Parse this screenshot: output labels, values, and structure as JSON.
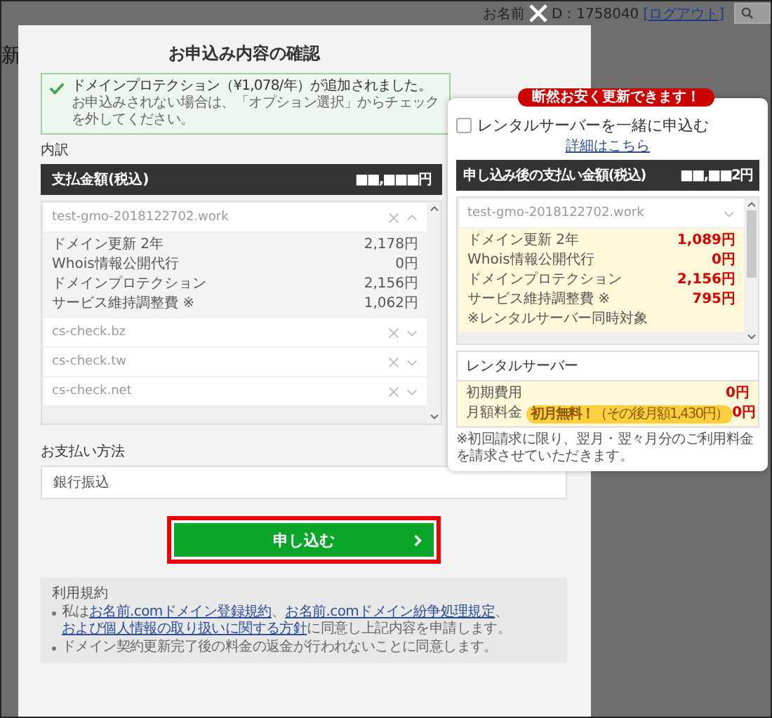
{
  "page_header": {
    "user_label": "お名前",
    "user_id": "D：1758040",
    "logout_link": "[ログアウト]",
    "side_text": "新"
  },
  "modal": {
    "title": "お申込み内容の確認",
    "notice": {
      "message": "ドメインプロテクション（¥1,078/年）が追加されました。",
      "sub": "お申込みされない場合は、「オプション選択」からチェックを外してください。"
    },
    "breakdown_label": "内訳",
    "total": {
      "label": "支払金額(税込)",
      "amount": "■■,■■■円"
    },
    "domains": [
      {
        "name": "test-gmo-2018122702.work",
        "expanded": true,
        "lines": [
          {
            "label": "ドメイン更新 2年",
            "amount": "2,178円"
          },
          {
            "label": "Whois情報公開代行",
            "amount": "0円"
          },
          {
            "label": "ドメインプロテクション",
            "amount": "2,156円"
          },
          {
            "label": "サービス維持調整費 ※",
            "amount": "1,062円"
          }
        ]
      },
      {
        "name": "cs-check.bz",
        "expanded": false
      },
      {
        "name": "cs-check.tw",
        "expanded": false
      },
      {
        "name": "cs-check.net",
        "expanded": false
      }
    ],
    "payment": {
      "label": "お支払い方法",
      "value": "銀行振込"
    },
    "submit": "申し込む",
    "terms": {
      "title": "利用規約",
      "items": [
        [
          {
            "kind": "text",
            "text": "私は"
          },
          {
            "kind": "link",
            "text": "お名前.comドメイン登録規約",
            "after": "、"
          },
          {
            "kind": "link",
            "text": "お名前.comドメイン紛争処理規定",
            "after": "、"
          },
          {
            "kind": "link",
            "text": "および個人情報の取り扱いに関する方針"
          },
          {
            "kind": "text",
            "text": "に同意し上記内容を申請します。"
          }
        ],
        [
          {
            "kind": "text",
            "text": "ドメイン契約更新完了後の料金の返金が行われないことに同意します。"
          }
        ]
      ]
    }
  },
  "popup": {
    "badge": "断然お安く更新できます！",
    "checkbox": {
      "label": "レンタルサーバーを一緒に申込む",
      "checked": false
    },
    "details_link": "詳細はこちら",
    "total": {
      "label": "申し込み後の支払い金額(税込)",
      "amount": "■■,■■2円"
    },
    "domain": {
      "name": "test-gmo-2018122702.work",
      "expanded": false,
      "lines": [
        {
          "label": "ドメイン更新 2年",
          "amount": "1,089円"
        },
        {
          "label": "Whois情報公開代行",
          "amount": "0円"
        },
        {
          "label": "ドメインプロテクション",
          "amount": "2,156円"
        },
        {
          "label": "サービス維持調整費 ※",
          "amount": "795円"
        }
      ],
      "note": "※レンタルサーバー同時対象"
    },
    "server": {
      "title": "レンタルサーバー",
      "lines": [
        {
          "label": "初期費用",
          "amount": "0円"
        },
        {
          "label": "月額料金",
          "badge": "**初月無料！**（その後月額1,430円）",
          "amount": "0円"
        }
      ]
    },
    "note": "※初回請求に限り、翌月・翌々月分のご利用料金を請求させていただきます。"
  }
}
